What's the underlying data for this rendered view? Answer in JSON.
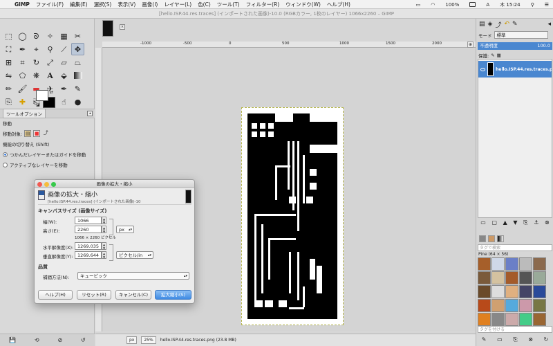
{
  "menubar": {
    "app": "GIMP",
    "items": [
      "ファイル(F)",
      "編集(E)",
      "選択(S)",
      "表示(V)",
      "画像(I)",
      "レイヤー(L)",
      "色(C)",
      "ツール(T)",
      "フィルター(R)",
      "ウィンドウ(W)",
      "ヘルプ(H)"
    ],
    "battery": "100%",
    "clock": "木 15:24",
    "input_mode": "A"
  },
  "window_title": "[hello.ISP.44.res.traces] (インポートされた画像)-10.0 (RGBカラー, 1枚のレイヤー) 1066x2260 – GIMP",
  "toolbox": {
    "tool_options_tab": "ツールオプション",
    "options": {
      "heading": "移動",
      "target_label": "移動対象:",
      "switch_label": "機能の切り替え (Shift)",
      "radio_1": "つかんだレイヤーまたはガイドを移動",
      "radio_2": "アクティブなレイヤーを移動"
    }
  },
  "ruler": {
    "ticks": [
      "-1000",
      "-500",
      "0",
      "500",
      "1000",
      "1500",
      "2000"
    ]
  },
  "status": {
    "unit": "px",
    "zoom": "25%",
    "file_info": "hello.ISP.44.res.traces.png (23.8 MB)"
  },
  "dock": {
    "mode_label": "モード",
    "mode_value": "標準",
    "opacity_label": "不透明度",
    "opacity_value": "100.0",
    "lock_label": "保護:",
    "layer_name": "hello.ISP.44.res.traces.pn",
    "tag_filter_placeholder": "タグで検索",
    "pattern_name": "Pine (64 × 56)",
    "tag_assign_placeholder": "タグを付ける"
  },
  "dialog": {
    "title": "画像の拡大・縮小",
    "heading": "画像の拡大・縮小",
    "subheading": "[hello.ISP.44.res.traces] (インポートされた画像)-10",
    "canvas_section": "キャンバスサイズ (画像サイズ)",
    "width_label": "幅(W):",
    "width_value": "1066",
    "height_label": "高さ(E):",
    "height_value": "2260",
    "unit_value": "px",
    "size_note": "1066 × 2260 ピクセル",
    "xres_label": "水平解像度(X):",
    "xres_value": "1269.035",
    "yres_label": "垂直解像度(Y):",
    "yres_value": "1269.644",
    "res_unit": "ピクセル/in",
    "quality_section": "品質",
    "interp_label": "補間方法(N):",
    "interp_value": "キュービック",
    "help_btn": "ヘルプ(H)",
    "reset_btn": "リセット(R)",
    "cancel_btn": "キャンセル(C)",
    "scale_btn": "拡大縮小(S)"
  }
}
